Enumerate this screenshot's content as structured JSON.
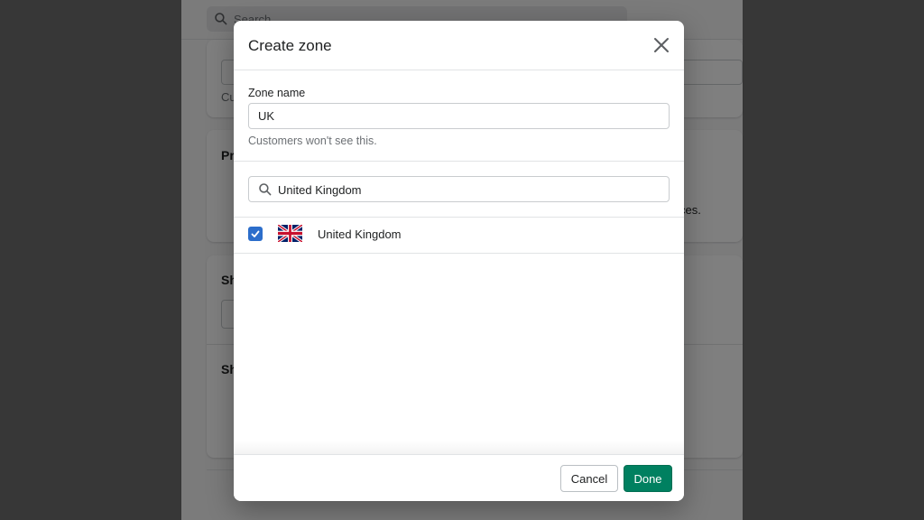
{
  "background": {
    "search_placeholder": "Search",
    "card_title_partial_1": "Pr",
    "card_title_partial_2": "Sh",
    "card_title_partial_3": "Sh",
    "help_partial": "Cu",
    "text_partial": "ces."
  },
  "modal": {
    "title": "Create zone",
    "close_icon": "close-icon",
    "zone_name_label": "Zone name",
    "zone_name_value": "UK",
    "zone_name_help": "Customers won't see this.",
    "search_value": "United Kingdom",
    "search_icon": "search-icon",
    "countries": [
      {
        "name": "United Kingdom",
        "checked": true,
        "flag": "uk-flag-icon"
      }
    ],
    "cancel_label": "Cancel",
    "done_label": "Done"
  },
  "colors": {
    "primary": "#008060",
    "checkbox": "#2c6ecb",
    "overlay": "rgba(0,0,0,0.5)"
  }
}
